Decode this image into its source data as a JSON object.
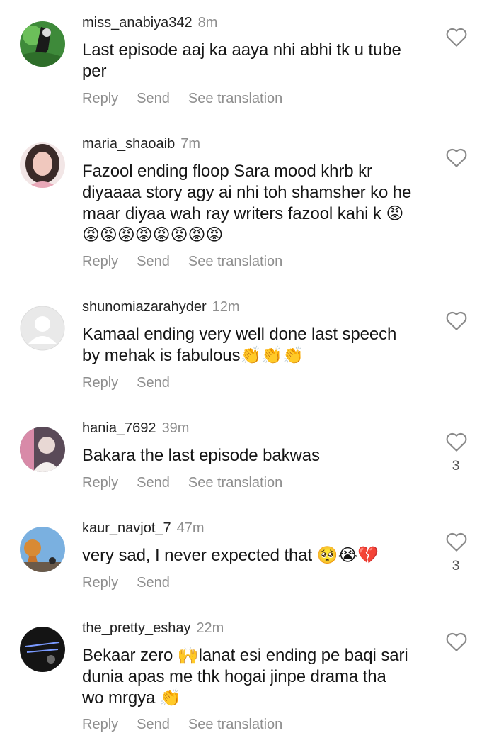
{
  "actions": {
    "reply": "Reply",
    "send": "Send",
    "see_translation": "See translation"
  },
  "comments": [
    {
      "username": "miss_anabiya342",
      "time": "8m",
      "lines": [
        "Last episode aaj ka aaya nhi abhi tk u tube",
        "per"
      ],
      "likes": ""
    },
    {
      "username": "maria_shaoaib",
      "time": "7m",
      "lines": [
        "Fazool ending floop Sara mood khrb kr",
        "diyaaaa story agy ai nhi toh shamsher ko he",
        "maar diyaa wah ray writers fazool kahi k 😡",
        "😡😡😡😡😡😡😡😡"
      ],
      "likes": ""
    },
    {
      "username": "shunomiazarahyder",
      "time": "12m",
      "lines": [
        "Kamaal ending very well done last speech",
        "by mehak is fabulous👏👏👏"
      ],
      "likes": ""
    },
    {
      "username": "hania_7692",
      "time": "39m",
      "lines": [
        "Bakara the last episode bakwas"
      ],
      "likes": "3"
    },
    {
      "username": "kaur_navjot_7",
      "time": "47m",
      "lines": [
        "very sad, I never expected that 🥺😭💔"
      ],
      "likes": "3"
    },
    {
      "username": "the_pretty_eshay",
      "time": "22m",
      "lines": [
        "Bekaar zero 🙌lanat esi ending pe baqi sari",
        "dunia apas me thk hogai jinpe drama tha",
        "wo mrgya 👏"
      ],
      "likes": ""
    }
  ],
  "icons": [
    "heart-icon",
    "default-avatar-icon"
  ]
}
